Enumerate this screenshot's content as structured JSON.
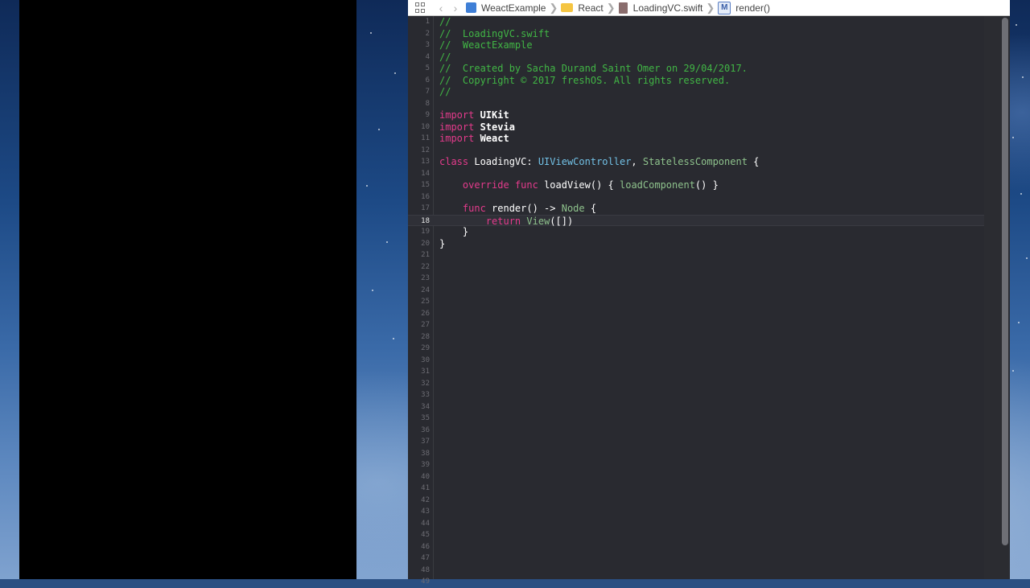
{
  "jumpbar": {
    "items": [
      {
        "label": "WeactExample",
        "icon": "project-icon"
      },
      {
        "label": "React",
        "icon": "folder-icon"
      },
      {
        "label": "LoadingVC.swift",
        "icon": "swift-file-icon"
      },
      {
        "label": "render()",
        "icon": "method-icon",
        "badge": "M"
      }
    ]
  },
  "editor": {
    "current_line": 18,
    "lines": [
      [
        {
          "t": "//",
          "c": "comment"
        }
      ],
      [
        {
          "t": "//  LoadingVC.swift",
          "c": "comment"
        }
      ],
      [
        {
          "t": "//  WeactExample",
          "c": "comment"
        }
      ],
      [
        {
          "t": "//",
          "c": "comment"
        }
      ],
      [
        {
          "t": "//  Created by Sacha Durand Saint Omer on 29/04/2017.",
          "c": "comment"
        }
      ],
      [
        {
          "t": "//  Copyright © 2017 freshOS. All rights reserved.",
          "c": "comment"
        }
      ],
      [
        {
          "t": "//",
          "c": "comment"
        }
      ],
      [],
      [
        {
          "t": "import",
          "c": "kw"
        },
        {
          "t": " UIKit",
          "c": "bold"
        }
      ],
      [
        {
          "t": "import",
          "c": "kw"
        },
        {
          "t": " Stevia",
          "c": "bold"
        }
      ],
      [
        {
          "t": "import",
          "c": "kw"
        },
        {
          "t": " Weact",
          "c": "bold"
        }
      ],
      [],
      [
        {
          "t": "class",
          "c": "kw"
        },
        {
          "t": " LoadingVC: ",
          "c": "plain"
        },
        {
          "t": "UIViewController",
          "c": "type"
        },
        {
          "t": ", ",
          "c": "plain"
        },
        {
          "t": "StatelessComponent",
          "c": "proj"
        },
        {
          "t": " {",
          "c": "plain"
        }
      ],
      [],
      [
        {
          "t": "    ",
          "c": "plain"
        },
        {
          "t": "override",
          "c": "kw"
        },
        {
          "t": " ",
          "c": "plain"
        },
        {
          "t": "func",
          "c": "kw"
        },
        {
          "t": " loadView() { ",
          "c": "plain"
        },
        {
          "t": "loadComponent",
          "c": "proj"
        },
        {
          "t": "() }",
          "c": "plain"
        }
      ],
      [],
      [
        {
          "t": "    ",
          "c": "plain"
        },
        {
          "t": "func",
          "c": "kw"
        },
        {
          "t": " render() -> ",
          "c": "plain"
        },
        {
          "t": "Node",
          "c": "proj"
        },
        {
          "t": " {",
          "c": "plain"
        }
      ],
      [
        {
          "t": "        ",
          "c": "plain"
        },
        {
          "t": "return",
          "c": "kw"
        },
        {
          "t": " ",
          "c": "plain"
        },
        {
          "t": "View",
          "c": "proj"
        },
        {
          "t": "([])",
          "c": "plain"
        }
      ],
      [
        {
          "t": "    }",
          "c": "plain"
        }
      ],
      [
        {
          "t": "}",
          "c": "plain"
        }
      ],
      [],
      [],
      [],
      [],
      [],
      [],
      [],
      [],
      [],
      [],
      [],
      [],
      [],
      [],
      [],
      [],
      [],
      [],
      [],
      [],
      [],
      [],
      [],
      [],
      [],
      [],
      [],
      [],
      []
    ]
  },
  "colors": {
    "editor_bg": "#292a30",
    "comment": "#41b645",
    "keyword": "#e43b8c",
    "system_type": "#72c1e6",
    "project_type": "#8ec28c"
  }
}
